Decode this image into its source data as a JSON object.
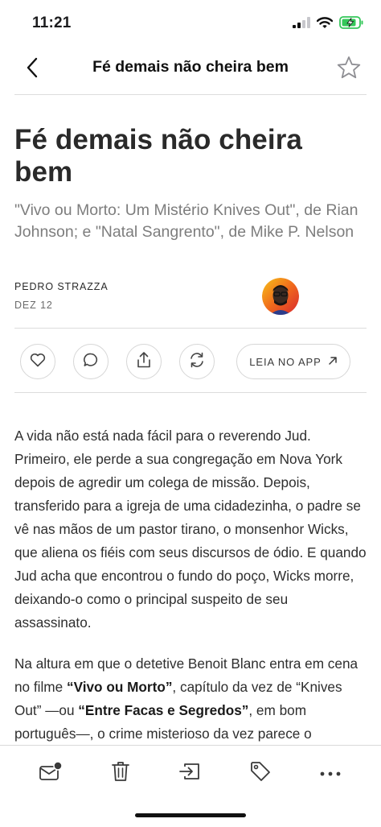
{
  "status_bar": {
    "time": "11:21",
    "icons": [
      "signal-icon",
      "wifi-icon",
      "battery-charging-icon"
    ]
  },
  "nav": {
    "title": "Fé demais não cheira bem",
    "back_icon": "back-chevron-icon",
    "star_icon": "star-icon"
  },
  "article": {
    "title": "Fé demais não cheira bem",
    "subtitle": "\"Vivo ou Morto: Um Mistério Knives Out\", de Rian Johnson; e \"Natal Sangrento\", de Mike P. Nelson",
    "author": "PEDRO STRAZZA",
    "date": "DEZ 12"
  },
  "actions": {
    "icons": [
      "heart-icon",
      "comment-icon",
      "share-icon",
      "restack-icon"
    ],
    "open_app_label": "LEIA NO APP"
  },
  "body": {
    "paragraph_1": "A vida não está nada fácil para o reverendo Jud. Primeiro, ele perde a sua congregação em Nova York depois de agredir um colega de missão. Depois, transferido para a igreja de uma cidadezinha, o padre se vê nas mãos de um pastor tirano, o monsenhor Wicks, que aliena os fiéis com seus discursos de ódio. E quando Jud acha que encontrou o fundo do poço, Wicks morre, deixando-o como o principal suspeito de seu assassinato.",
    "paragraph_2": {
      "t1": "Na altura em que o detetive Benoit Blanc entra em cena no filme ",
      "b1": "“Vivo ou Morto”",
      "t2": ", capítulo da vez de “Knives Out” —ou ",
      "b2": "“Entre Facas e Segredos”",
      "t3": ", em bom português—, o crime misterioso da vez parece o"
    }
  },
  "toolbar": {
    "icons": [
      "inbox-unread-icon",
      "trash-icon",
      "move-icon",
      "tag-icon",
      "more-icon"
    ]
  },
  "colors": {
    "text": "#2e2e2e",
    "muted": "#7d7d7d",
    "divider": "#dcdcdc",
    "battery": "#34c759"
  }
}
